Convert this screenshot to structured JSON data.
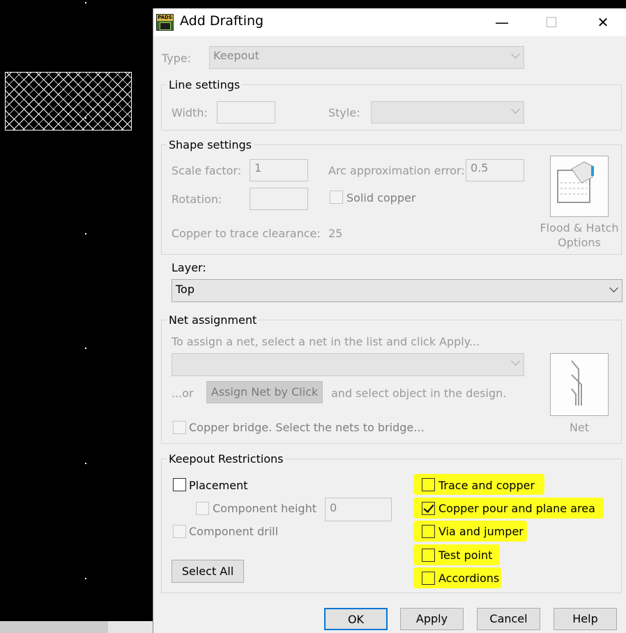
{
  "dialog": {
    "title": "Add Drafting",
    "app_icon_text": "PADS",
    "window_buttons": {
      "minimize": "—",
      "maximize": "☐",
      "close": "✕"
    }
  },
  "type": {
    "label": "Type:",
    "value": "Keepout"
  },
  "line_settings": {
    "title": "Line settings",
    "width_label": "Width:",
    "width_value": "",
    "style_label": "Style:",
    "style_value": ""
  },
  "shape_settings": {
    "title": "Shape settings",
    "scale_label": "Scale factor:",
    "scale_value": "1",
    "arc_label": "Arc approximation error:",
    "arc_value": "0.5",
    "rotation_label": "Rotation:",
    "rotation_value": "",
    "solid_copper_label": "Solid copper",
    "solid_copper_checked": false,
    "clearance_label": "Copper to trace clearance:",
    "clearance_value": "25",
    "flood_label_1": "Flood & Hatch",
    "flood_label_2": "Options"
  },
  "layer": {
    "label": "Layer:",
    "value": "Top"
  },
  "net_assignment": {
    "title": "Net assignment",
    "instruction": "To assign a net, select a net in the list and click Apply...",
    "net_value": "",
    "or_label": "...or",
    "assign_button": "Assign Net by Click",
    "after_text": "and select object in the design.",
    "copper_bridge_label": "Copper bridge. Select the nets to bridge...",
    "net_button_label": "Net"
  },
  "keepout": {
    "title": "Keepout Restrictions",
    "placement": {
      "label": "Placement",
      "checked": false
    },
    "component_height": {
      "label": "Component height",
      "value": "0",
      "checked": false
    },
    "component_drill": {
      "label": "Component drill",
      "checked": false
    },
    "select_all": "Select All",
    "right_options": [
      {
        "label": "Trace and copper",
        "checked": false
      },
      {
        "label": "Copper pour and plane area",
        "checked": true
      },
      {
        "label": "Via and jumper",
        "checked": false
      },
      {
        "label": "Test point",
        "checked": false
      },
      {
        "label": "Accordions",
        "checked": false
      }
    ],
    "highlight_color": "#ffff1e"
  },
  "footer": {
    "ok": "OK",
    "apply": "Apply",
    "cancel": "Cancel",
    "help": "Help"
  }
}
